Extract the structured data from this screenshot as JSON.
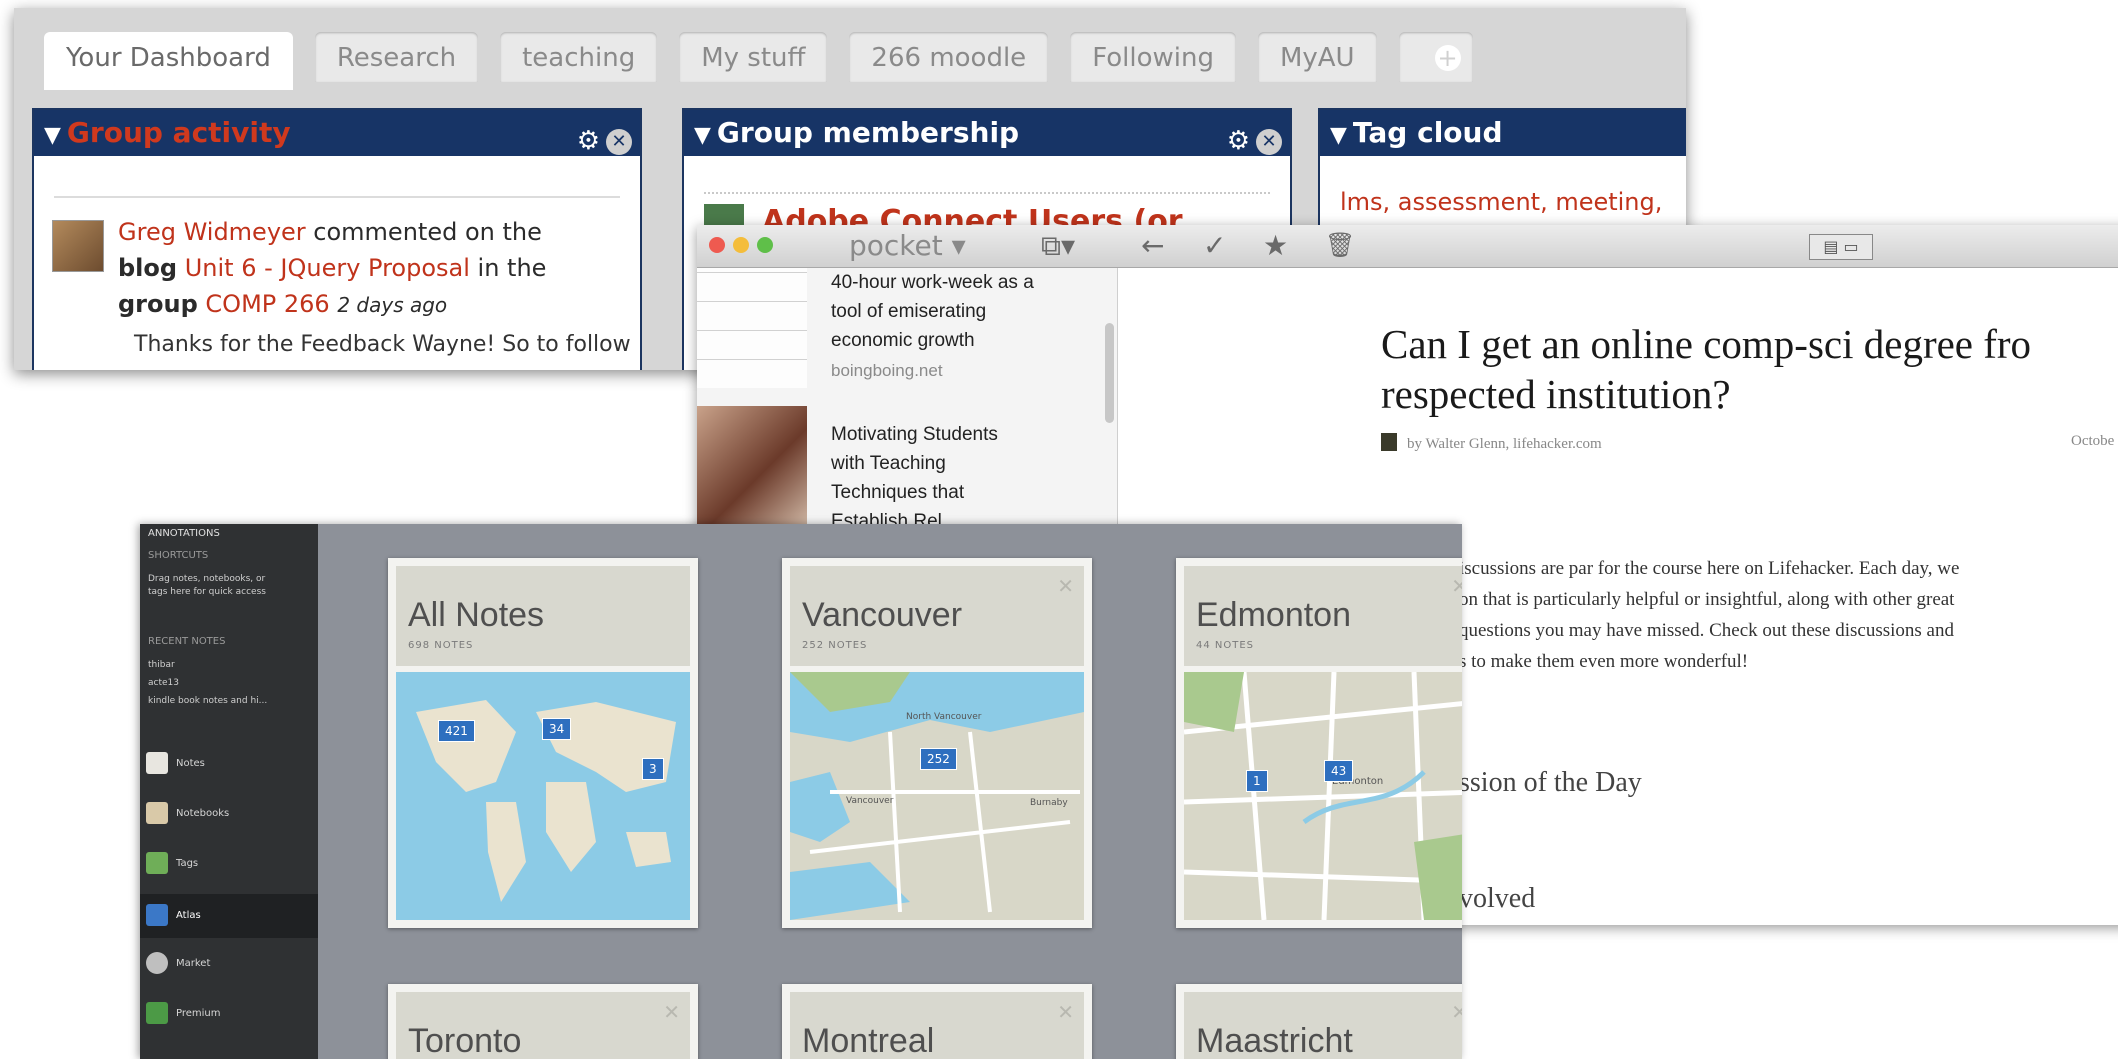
{
  "dashboard": {
    "tabs": [
      "Your Dashboard",
      "Research",
      "teaching",
      "My stuff",
      "266 moodle",
      "Following",
      "MyAU"
    ],
    "add_tab_icon": "plus-icon",
    "panels": {
      "group_activity": {
        "title": "Group activity",
        "entry": {
          "user": "Greg Widmeyer",
          "verb": "commented on the",
          "object_type": "blog",
          "object": "Unit 6 - JQuery Proposal",
          "in_group": "in the",
          "group_word": "group",
          "group": "COMP 266",
          "when": "2 days ago",
          "excerpt": "Thanks for the Feedback Wayne! So to follow"
        }
      },
      "group_membership": {
        "title": "Group membership",
        "first_item": "Adobe Connect Users (or"
      },
      "tag_cloud": {
        "title": "Tag cloud",
        "tags": "lms, assessment, meeting,"
      }
    }
  },
  "pocket": {
    "app_title": "pocket",
    "list": [
      {
        "title_lines": [
          "40-hour work-week as a",
          "tool of emiserating",
          "economic growth"
        ],
        "source": "boingboing.net"
      },
      {
        "title_lines": [
          "Motivating Students",
          "with Teaching",
          "Techniques that",
          "Establish Rel..."
        ],
        "source": ""
      }
    ],
    "article": {
      "title_lines": [
        "Can I get an online comp-sci degree fro",
        "respected institution?"
      ],
      "byline": "by Walter Glenn, lifehacker.com",
      "date": "Octobe",
      "body": [
        "iscussions are par for the course here on Lifehacker. Each day, we",
        "on that is particularly helpful or insightful, along with other great",
        "questions you may have missed. Check out these discussions and",
        "s to make them even more wonderful!"
      ],
      "heading1": "ssion of the Day",
      "heading2": "volved"
    }
  },
  "atlas": {
    "sidebar": {
      "account": "ANNOTATIONS",
      "shortcuts_title": "SHORTCUTS",
      "shortcuts_hint": [
        "Drag notes, notebooks, or",
        "tags here for quick access"
      ],
      "recent_title": "RECENT NOTES",
      "recent": [
        "thibar",
        "acte13",
        "kindle book notes and hi..."
      ],
      "nav": [
        "Notes",
        "Notebooks",
        "Tags",
        "Atlas",
        "Market",
        "Premium"
      ]
    },
    "cards": [
      {
        "name": "All Notes",
        "count": "698 NOTES",
        "markers": [
          "421",
          "34",
          "3"
        ]
      },
      {
        "name": "Vancouver",
        "count": "252 NOTES",
        "markers": [
          "252"
        ],
        "labels": [
          "North Vancouver",
          "Vancouver",
          "Burnaby"
        ]
      },
      {
        "name": "Edmonton",
        "count": "44 NOTES",
        "markers": [
          "1",
          "43"
        ],
        "labels": [
          "Edmonton"
        ]
      },
      {
        "name": "Toronto",
        "count": "",
        "markers": []
      },
      {
        "name": "Montreal",
        "count": "",
        "markers": []
      },
      {
        "name": "Maastricht",
        "count": "",
        "markers": []
      }
    ]
  }
}
